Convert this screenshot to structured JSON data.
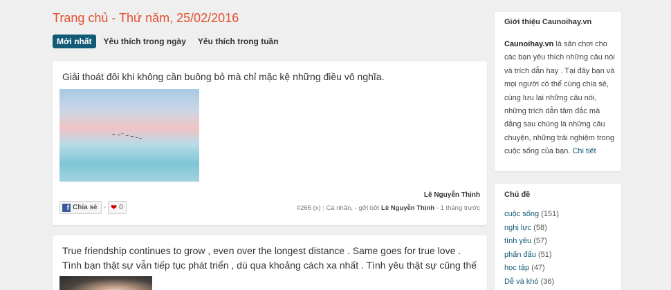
{
  "header": {
    "title": "Trang chủ - Thứ năm, 25/02/2016"
  },
  "tabs": [
    {
      "label": "Mới nhất",
      "active": true
    },
    {
      "label": "Yêu thích trong ngày",
      "active": false
    },
    {
      "label": "Yêu thích trong tuần",
      "active": false
    }
  ],
  "posts": [
    {
      "text": "Giải thoát đôi khi không cần buông bỏ mà chỉ mặc kệ những điều vô nghĩa.",
      "author": "Lê Nguyễn Thịnh",
      "share_label": "Chia sẻ",
      "separator": "-",
      "likes": "0",
      "meta": {
        "id": "#265",
        "flag": "(x)",
        "category": "Cá nhân,",
        "by_prefix": "- gởi bởi",
        "poster": "Lê Nguyễn Thịnh",
        "time": "- 1 tháng trước"
      }
    },
    {
      "text": "True friendship continues to grow , even over the longest distance . Same goes for true love . Tình bạn thật sự vẫn tiếp tục phát triển , dù qua khoảng cách xa nhất . Tình yêu thật sự cũng thế ."
    }
  ],
  "sidebar": {
    "intro": {
      "title": "Giới thiệu Caunoihay.vn",
      "brand": "Caunoihay.vn",
      "body": " là sân chơi cho các bạn yêu thích những câu nói và trích dẫn hay . Tại đây bạn và mọi người có thể cùng chia sẻ, cùng lưu lại những câu nói, những trích dẫn tâm đắc mà đằng sau chúng là những câu chuyện, những trải nghiệm trong cuộc sống của bạn. ",
      "more_link": "Chi tiết"
    },
    "topics": {
      "title": "Chủ đề",
      "items": [
        {
          "name": "cuộc sống",
          "count": "(151)"
        },
        {
          "name": "nghị lực",
          "count": "(58)"
        },
        {
          "name": "tình yêu",
          "count": "(57)"
        },
        {
          "name": "phấn đấu",
          "count": "(51)"
        },
        {
          "name": "học tập",
          "count": "(47)"
        },
        {
          "name": "Dễ và khó",
          "count": "(36)"
        }
      ]
    }
  },
  "colors": {
    "accent_title": "#e2512f",
    "tab_active": "#125a75",
    "link": "#125a75",
    "heart": "#cc0000",
    "facebook": "#3b5998"
  }
}
